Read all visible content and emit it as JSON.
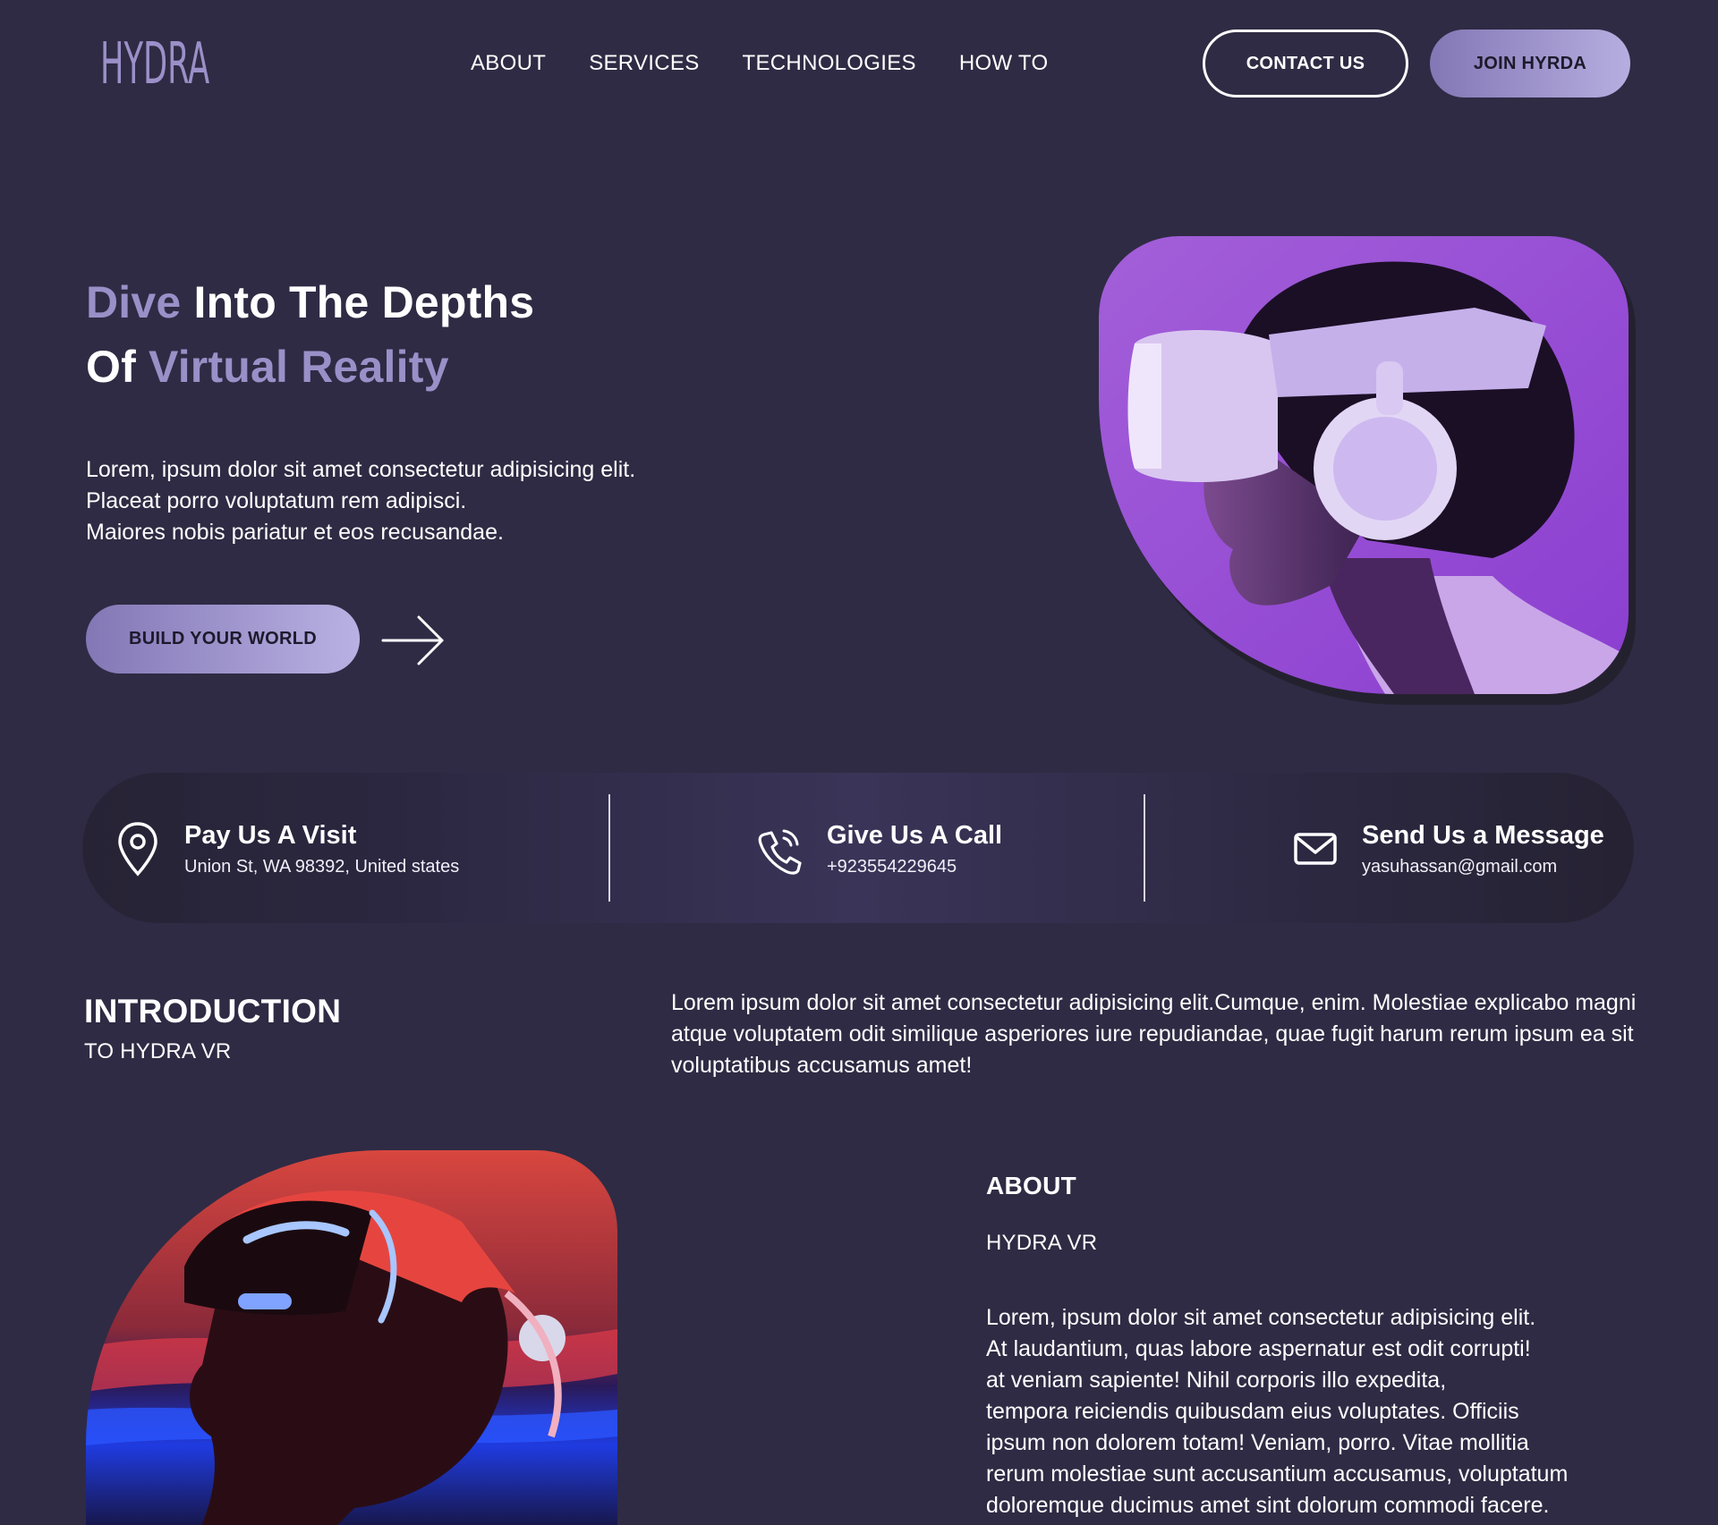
{
  "header": {
    "logo_text": "HYDRA",
    "nav": [
      "ABOUT",
      "SERVICES",
      "TECHNOLOGIES",
      "HOW TO"
    ],
    "contact_label": "CONTACT US",
    "join_label": "JOIN HYRDA"
  },
  "hero": {
    "title_line1_accent": "Dive",
    "title_line1_rest": " Into The Depths",
    "title_line2_start": "Of ",
    "title_line2_accent": "Virtual Reality",
    "desc_lines": [
      "Lorem, ipsum dolor sit amet consectetur adipisicing elit.",
      "Placeat porro voluptatum rem adipisci.",
      "Maiores nobis pariatur et eos recusandae."
    ],
    "cta_label": "BUILD YOUR WORLD"
  },
  "contact": [
    {
      "title": "Pay Us A Visit",
      "detail": "Union St, WA 98392, United states",
      "icon": "map-pin-icon"
    },
    {
      "title": "Give Us A Call",
      "detail": "+923554229645",
      "icon": "phone-icon"
    },
    {
      "title": "Send Us a Message",
      "detail": "yasuhassan@gmail.com",
      "icon": "mail-icon"
    }
  ],
  "intro": {
    "title": "INTRODUCTION",
    "subtitle": "TO HYDRA VR",
    "text": "Lorem ipsum dolor sit amet consectetur adipisicing elit.Cumque, enim. Molestiae explicabo magni atque voluptatem odit similique asperiores iure repudiandae, quae fugit harum rerum ipsum ea sit voluptatibus accusamus amet!"
  },
  "about": {
    "title": "ABOUT",
    "subtitle": "HYDRA VR",
    "text": "Lorem, ipsum dolor sit amet consectetur adipisicing elit.\nAt laudantium, quas labore aspernatur est odit corrupti!\nat veniam sapiente! Nihil corporis illo expedita,\ntempora reiciendis quibusdam eius voluptates. Officiis\nipsum non dolorem totam! Veniam, porro. Vitae mollitia\nrerum molestiae sunt accusantium accusamus, voluptatum\ndoloremque ducimus amet sint dolorum commodi facere."
  },
  "colors": {
    "background": "#2f2b44",
    "accent": "#9a90c8",
    "button_gradient_start": "#8377b5",
    "button_gradient_end": "#b9b1e3"
  }
}
